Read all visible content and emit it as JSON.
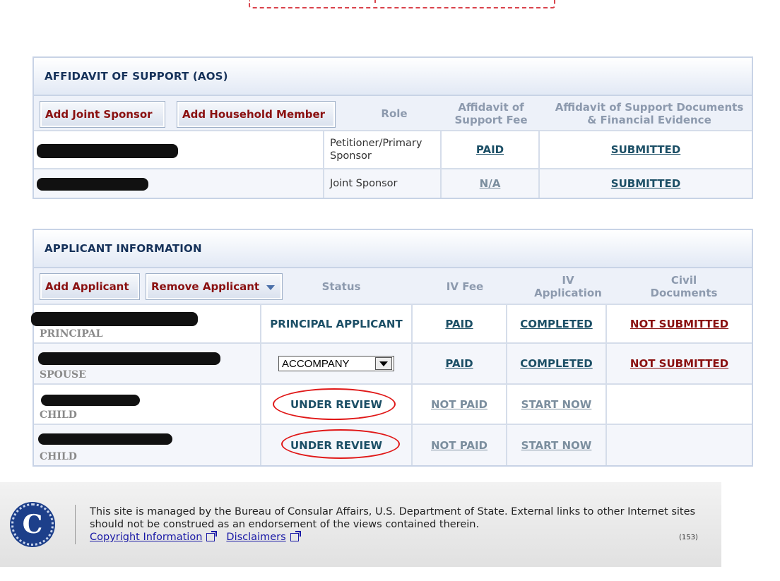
{
  "aos": {
    "title": "AFFIDAVIT OF SUPPORT (AOS)",
    "buttons": {
      "add_joint_sponsor": "Add Joint Sponsor",
      "add_household_member": "Add Household Member"
    },
    "columns": {
      "role": "Role",
      "fee": "Affidavit of Support Fee",
      "documents": "Affidavit of Support Documents & Financial Evidence"
    },
    "rows": [
      {
        "name": "",
        "role": "Petitioner/Primary Sponsor",
        "fee": "PAID",
        "documents": "SUBMITTED"
      },
      {
        "name": "",
        "role": "Joint Sponsor",
        "fee": "N/A",
        "documents": "SUBMITTED"
      }
    ]
  },
  "applicants": {
    "title": "APPLICANT INFORMATION",
    "buttons": {
      "add_applicant": "Add Applicant",
      "remove_applicant": "Remove Applicant"
    },
    "columns": {
      "status": "Status",
      "iv_fee": "IV Fee",
      "iv_application": "IV Application",
      "civil_documents": "Civil Documents"
    },
    "rows": [
      {
        "relationship": "PRINCIPAL",
        "status": "PRINCIPAL APPLICANT",
        "iv_fee": "PAID",
        "iv_application": "COMPLETED",
        "civil_documents": "NOT SUBMITTED"
      },
      {
        "relationship": "SPOUSE",
        "status": "ACCOMPANY",
        "iv_fee": "PAID",
        "iv_application": "COMPLETED",
        "civil_documents": "NOT SUBMITTED"
      },
      {
        "relationship": "CHILD",
        "status": "UNDER REVIEW",
        "iv_fee": "NOT PAID",
        "iv_application": "START NOW",
        "civil_documents": ""
      },
      {
        "relationship": "CHILD",
        "status": "UNDER REVIEW",
        "iv_fee": "NOT PAID",
        "iv_application": "START NOW",
        "civil_documents": ""
      }
    ]
  },
  "footer": {
    "seal_letter": "C",
    "text": "This site is managed by the Bureau of Consular Affairs, U.S. Department of State. External links to other Internet sites should not be construed as an endorsement of the views contained therein.",
    "links": {
      "copyright": "Copyright Information",
      "disclaimers": "Disclaimers"
    },
    "page_code": "(153)"
  },
  "colors": {
    "header_navy": "#16325a",
    "link_teal": "#1c4f66",
    "link_grey": "#7b8e9e",
    "alert_red": "#8a1010",
    "annotation_red": "#e01818"
  },
  "icons": {
    "seal": "consular-affairs-seal-icon",
    "external_link": "external-link-icon",
    "dropdown": "chevron-down-icon"
  }
}
